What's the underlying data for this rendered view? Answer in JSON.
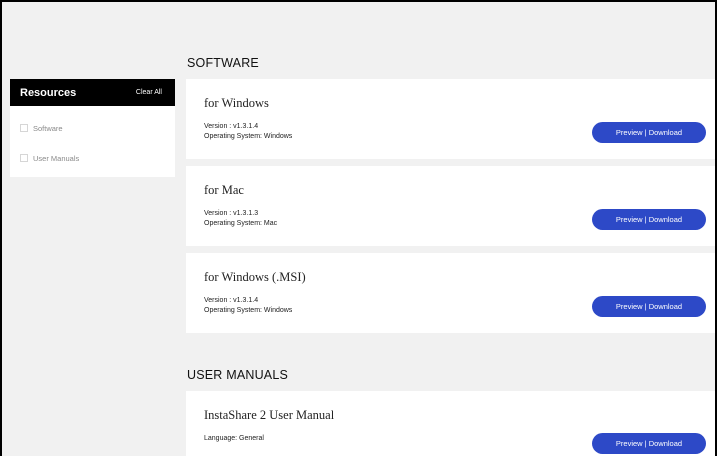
{
  "sidebar": {
    "title": "Resources",
    "clear_all": "Clear All",
    "filters": [
      {
        "label": "Software",
        "checked": false
      },
      {
        "label": "User Manuals",
        "checked": false
      }
    ]
  },
  "sections": {
    "software_heading": "SOFTWARE",
    "manuals_heading": "USER MANUALS"
  },
  "software": [
    {
      "title": "for Windows",
      "version": "Version : v1.3.1.4",
      "os": "Operating System: Windows",
      "button": "Preview | Download"
    },
    {
      "title": "for Mac",
      "version": "Version : v1.3.1.3",
      "os": "Operating System: Mac",
      "button": "Preview | Download"
    },
    {
      "title": "for Windows (.MSI)",
      "version": "Version : v1.3.1.4",
      "os": "Operating System: Windows",
      "button": "Preview | Download"
    }
  ],
  "manuals": [
    {
      "title": "InstaShare 2 User Manual",
      "language": "Language: General",
      "button": "Preview | Download"
    }
  ],
  "colors": {
    "accent_button": "#2d49c7",
    "header_bg": "#000000",
    "page_bg": "#f1f1f1"
  }
}
